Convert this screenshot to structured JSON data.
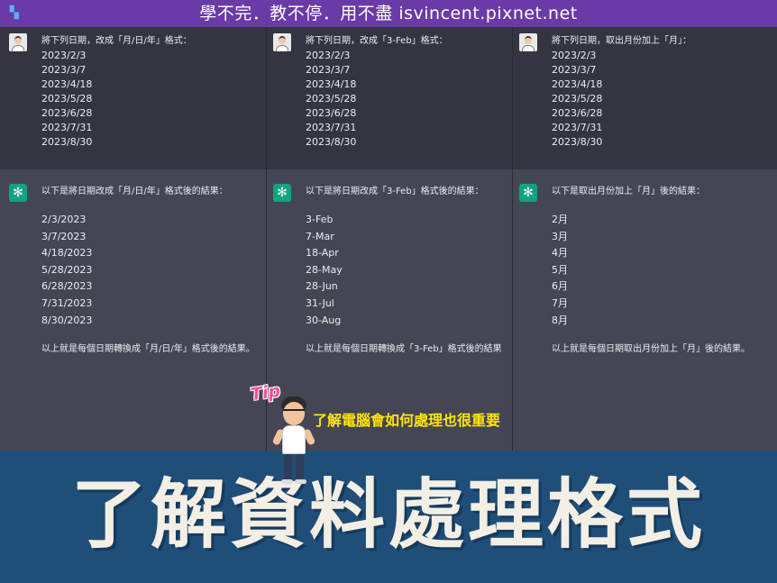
{
  "banner": {
    "text": "學不完．教不停．用不盡 isvincent.pixnet.net",
    "corner_glyph": "▚"
  },
  "columns": [
    {
      "user": {
        "prompt": "將下列日期，改成「月/日/年」格式：",
        "dates": [
          "2023/2/3",
          "2023/3/7",
          "2023/4/18",
          "2023/5/28",
          "2023/6/28",
          "2023/7/31",
          "2023/8/30"
        ]
      },
      "bot": {
        "intro": "以下是將日期改成「月/日/年」格式後的結果：",
        "results": [
          "2/3/2023",
          "3/7/2023",
          "4/18/2023",
          "5/28/2023",
          "6/28/2023",
          "7/31/2023",
          "8/30/2023"
        ],
        "outro": "以上就是每個日期轉換成「月/日/年」格式後的結果。"
      }
    },
    {
      "user": {
        "prompt": "將下列日期，改成「3-Feb」格式：",
        "dates": [
          "2023/2/3",
          "2023/3/7",
          "2023/4/18",
          "2023/5/28",
          "2023/6/28",
          "2023/7/31",
          "2023/8/30"
        ]
      },
      "bot": {
        "intro": "以下是將日期改成「3-Feb」格式後的結果：",
        "results": [
          "3-Feb",
          "7-Mar",
          "18-Apr",
          "28-May",
          "28-Jun",
          "31-Jul",
          "30-Aug"
        ],
        "outro": "以上就是每個日期轉換成「3-Feb」格式後的結果"
      }
    },
    {
      "user": {
        "prompt": "將下列日期，取出月份加上「月」：",
        "dates": [
          "2023/2/3",
          "2023/3/7",
          "2023/4/18",
          "2023/5/28",
          "2023/6/28",
          "2023/7/31",
          "2023/8/30"
        ]
      },
      "bot": {
        "intro": "以下是取出月份加上「月」後的結果：",
        "results": [
          "2月",
          "3月",
          "4月",
          "5月",
          "6月",
          "7月",
          "8月"
        ],
        "outro": "以上就是每個日期取出月份加上「月」後的結果。"
      }
    }
  ],
  "tip": {
    "label": "Tip",
    "caption": "了解電腦會如何處理也很重要"
  },
  "title": "了解資料處理格式",
  "colors": {
    "banner": "#6a3aa6",
    "bot_bg": "#444654",
    "user_bg": "#343541",
    "band": "#1f4e79",
    "caption": "#ffe600",
    "tip": "#ff4f9a"
  }
}
